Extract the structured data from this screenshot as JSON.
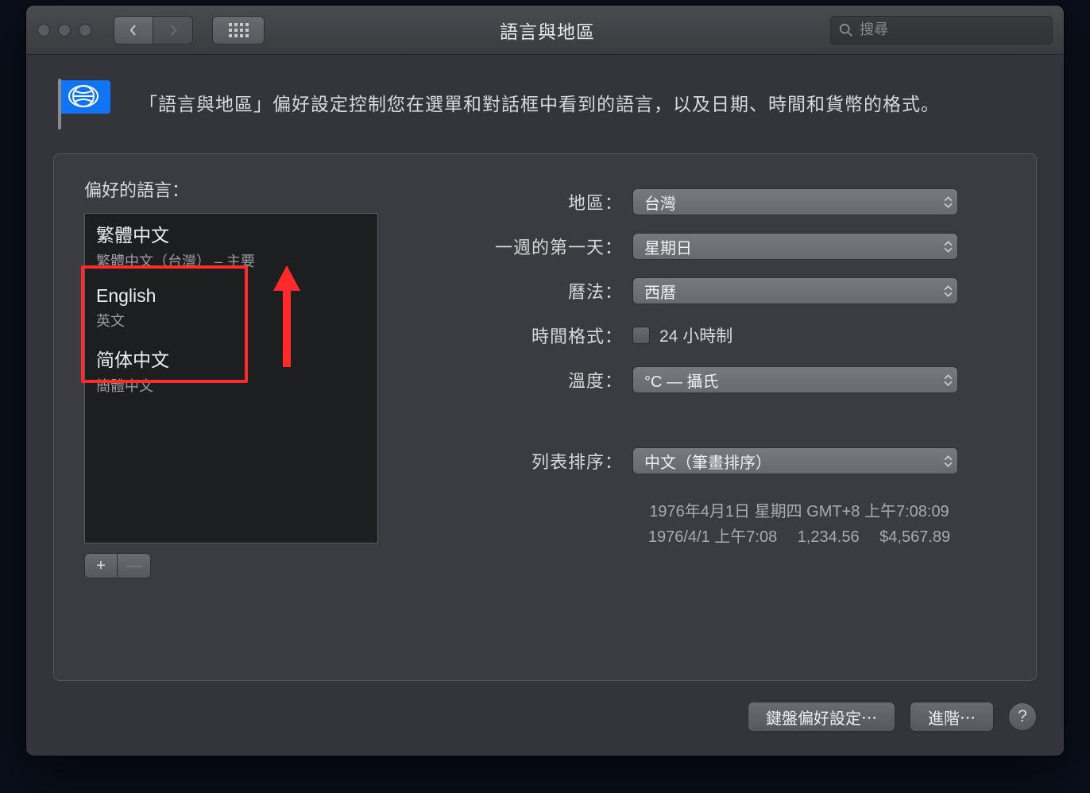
{
  "window": {
    "title": "語言與地區",
    "search_placeholder": "搜尋"
  },
  "heading": "「語言與地區」偏好設定控制您在選單和對話框中看到的語言，以及日期、時間和貨幣的格式。",
  "left": {
    "label": "偏好的語言：",
    "items": [
      {
        "name": "繁體中文",
        "sub": "繁體中文（台灣）  – 主要"
      },
      {
        "name": "English",
        "sub": "英文"
      },
      {
        "name": "简体中文",
        "sub": "簡體中文"
      }
    ],
    "add": "+",
    "remove": "—"
  },
  "form": {
    "region_label": "地區：",
    "region_value": "台灣",
    "firstday_label": "一週的第一天：",
    "firstday_value": "星期日",
    "calendar_label": "曆法：",
    "calendar_value": "西曆",
    "timefmt_label": "時間格式：",
    "timefmt_value": "24 小時制",
    "temp_label": "溫度：",
    "temp_value": "°C — 攝氏",
    "sort_label": "列表排序：",
    "sort_value": "中文（筆畫排序）"
  },
  "example": {
    "line1": "1976年4月1日 星期四 GMT+8 上午7:08:09",
    "line2": "1976/4/1 上午7:08  1,234.56  $4,567.89"
  },
  "footer": {
    "keyboard": "鍵盤偏好設定⋯",
    "advanced": "進階⋯",
    "help": "?"
  }
}
